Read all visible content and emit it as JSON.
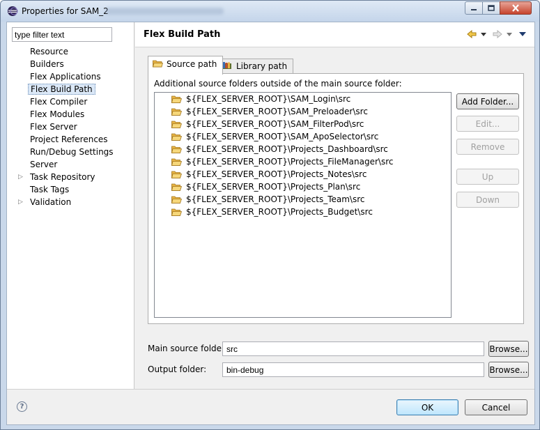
{
  "window": {
    "title": "Properties for SAM_2",
    "controls": [
      "minimize-icon",
      "maximize-icon",
      "close-icon"
    ]
  },
  "sidebar": {
    "filter_placeholder": "type filter text",
    "items": [
      {
        "label": "Resource",
        "expandable": false
      },
      {
        "label": "Builders",
        "expandable": false
      },
      {
        "label": "Flex Applications",
        "expandable": false
      },
      {
        "label": "Flex Build Path",
        "expandable": false,
        "selected": true
      },
      {
        "label": "Flex Compiler",
        "expandable": false
      },
      {
        "label": "Flex Modules",
        "expandable": false
      },
      {
        "label": "Flex Server",
        "expandable": false
      },
      {
        "label": "Project References",
        "expandable": false
      },
      {
        "label": "Run/Debug Settings",
        "expandable": false
      },
      {
        "label": "Server",
        "expandable": false
      },
      {
        "label": "Task Repository",
        "expandable": true
      },
      {
        "label": "Task Tags",
        "expandable": false
      },
      {
        "label": "Validation",
        "expandable": true
      }
    ]
  },
  "page": {
    "title": "Flex Build Path",
    "nav_icons": [
      "back-arrow-icon",
      "back-dropdown-icon",
      "forward-arrow-icon",
      "forward-dropdown-icon",
      "view-menu-icon"
    ]
  },
  "tabs": [
    {
      "label": "Source path",
      "active": true,
      "icon": "folder-icon"
    },
    {
      "label": "Library path",
      "active": false,
      "icon": "library-icon"
    }
  ],
  "source_path": {
    "label": "Additional source folders outside of the main source folder:",
    "folders": [
      "${FLEX_SERVER_ROOT}\\SAM_Login\\src",
      "${FLEX_SERVER_ROOT}\\SAM_Preloader\\src",
      "${FLEX_SERVER_ROOT}\\SAM_FilterPod\\src",
      "${FLEX_SERVER_ROOT}\\SAM_ApoSelector\\src",
      "${FLEX_SERVER_ROOT}\\Projects_Dashboard\\src",
      "${FLEX_SERVER_ROOT}\\Projects_FileManager\\src",
      "${FLEX_SERVER_ROOT}\\Projects_Notes\\src",
      "${FLEX_SERVER_ROOT}\\Projects_Plan\\src",
      "${FLEX_SERVER_ROOT}\\Projects_Team\\src",
      "${FLEX_SERVER_ROOT}\\Projects_Budget\\src"
    ],
    "buttons": {
      "add_folder": "Add Folder...",
      "edit": "Edit...",
      "remove": "Remove",
      "up": "Up",
      "down": "Down"
    }
  },
  "fields": {
    "main_source_label": "Main source folder:",
    "main_source_value": "src",
    "output_label": "Output folder:",
    "output_value": "bin-debug",
    "browse_label": "Browse..."
  },
  "footer": {
    "help_icon": "help-icon",
    "ok_label": "OK",
    "cancel_label": "Cancel"
  },
  "colors": {
    "window_frame": "#c9d8ea",
    "dialog_bg": "#f0f0f0",
    "selection": "#dbe8f7",
    "folder": "#e8b444",
    "close_button": "#c6432c"
  }
}
